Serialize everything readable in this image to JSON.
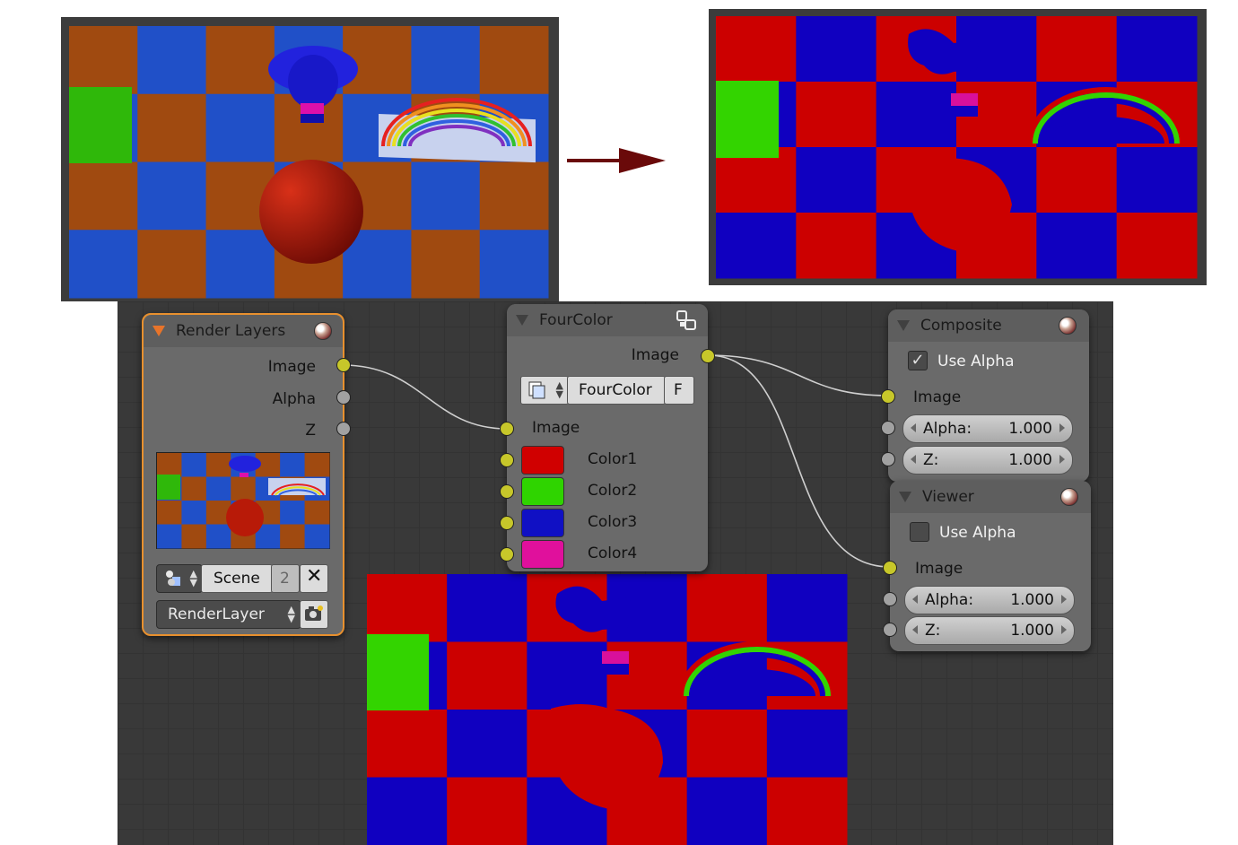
{
  "render_layers": {
    "title": "Render Layers",
    "outputs": [
      "Image",
      "Alpha",
      "Z"
    ],
    "scene_label": "Scene",
    "scene_users": "2",
    "layer_label": "RenderLayer"
  },
  "fourcolor": {
    "title": "FourColor",
    "output": "Image",
    "group_label": "FourColor",
    "fake_user": "F",
    "input_image": "Image",
    "colors": [
      {
        "label": "Color1",
        "hex": "#d00000"
      },
      {
        "label": "Color2",
        "hex": "#2fd400"
      },
      {
        "label": "Color3",
        "hex": "#1010c4"
      },
      {
        "label": "Color4",
        "hex": "#e0109c"
      }
    ]
  },
  "composite": {
    "title": "Composite",
    "use_alpha_label": "Use Alpha",
    "use_alpha_checked": true,
    "input_image": "Image",
    "alpha_label": "Alpha:",
    "alpha_value": "1.000",
    "z_label": "Z:",
    "z_value": "1.000"
  },
  "viewer": {
    "title": "Viewer",
    "use_alpha_label": "Use Alpha",
    "use_alpha_checked": false,
    "input_image": "Image",
    "alpha_label": "Alpha:",
    "alpha_value": "1.000",
    "z_label": "Z:",
    "z_value": "1.000"
  },
  "colors": {
    "arrow": "#6a0a0a",
    "socket_yellow": "#c7c72a",
    "socket_gray": "#a1a1a1",
    "node_body": "#6a6a6a",
    "active_outline": "#e8902e",
    "render_orange": "#a04a10",
    "render_blue": "#2050c8",
    "out_red": "#cc0000",
    "out_blue": "#1000c0",
    "out_green": "#33d400",
    "out_magenta": "#d8109c"
  },
  "icons": [
    "arrow-right-icon",
    "node-group-icon",
    "material-ball-icon",
    "expand-triangle-icon",
    "scene-icon",
    "close-icon",
    "render-layer-camera-icon",
    "checkmark-icon",
    "monkey-head-icon",
    "rainbow-icon",
    "sphere-icon"
  ]
}
